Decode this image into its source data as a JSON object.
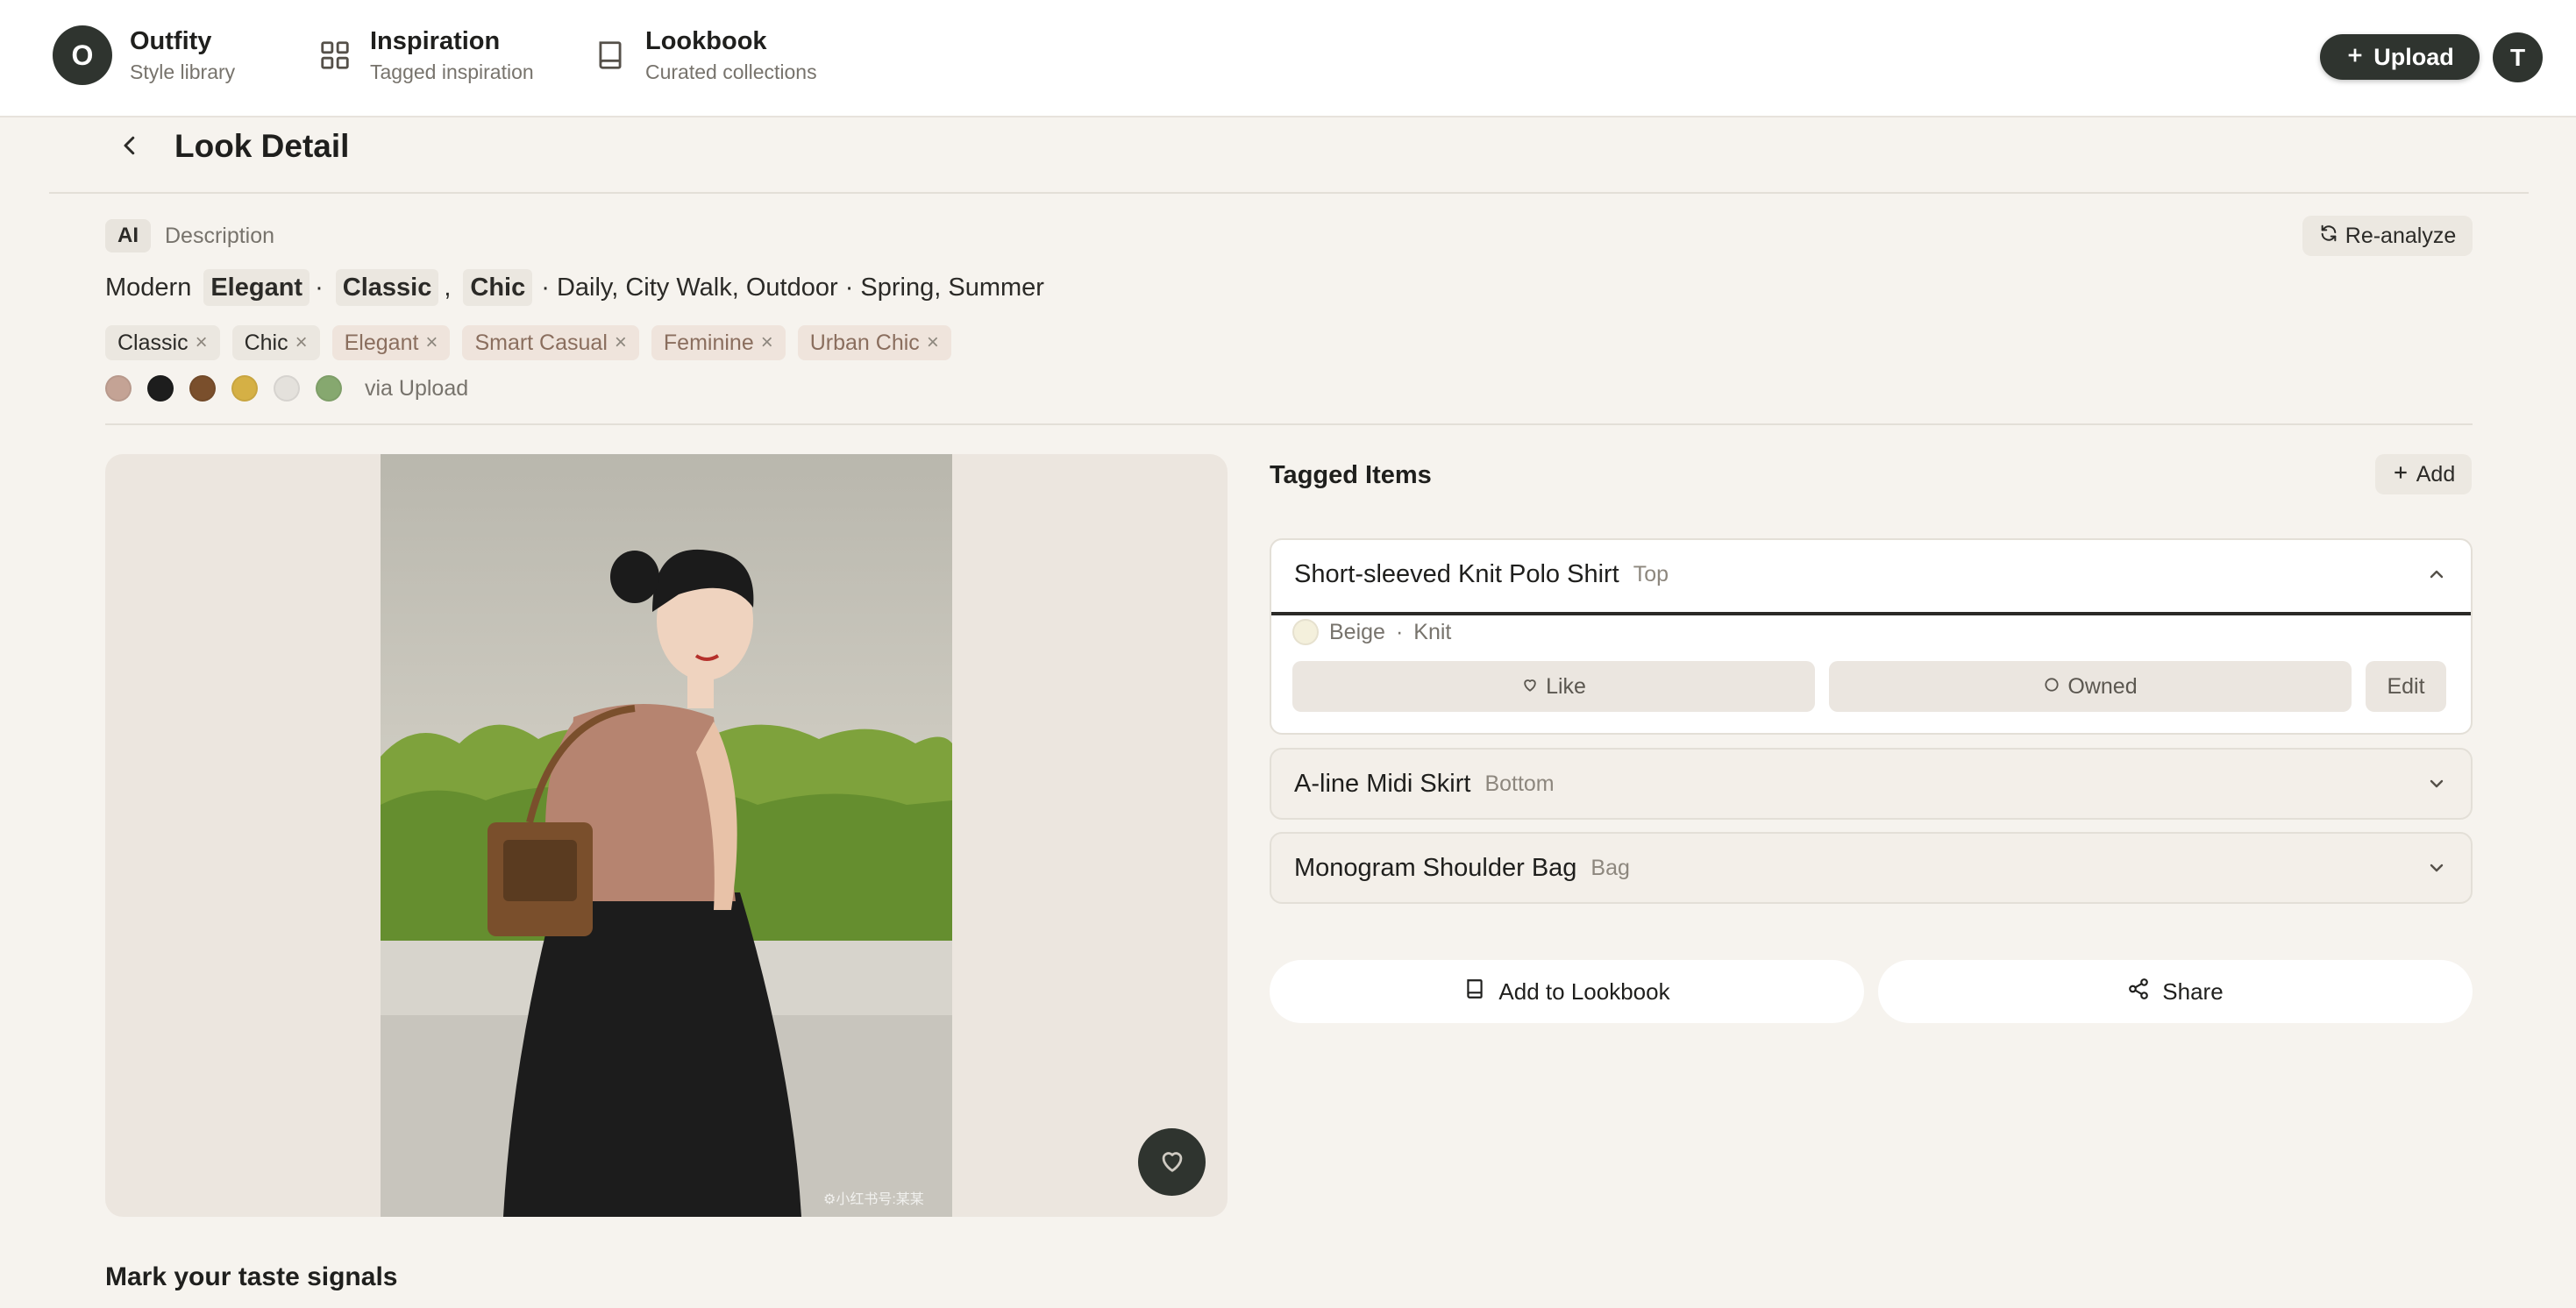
{
  "nav": {
    "brand": {
      "initial": "O",
      "title": "Outfity",
      "subtitle": "Style library"
    },
    "items": [
      {
        "title": "Inspiration",
        "subtitle": "Tagged inspiration",
        "icon": "grid-icon"
      },
      {
        "title": "Lookbook",
        "subtitle": "Curated collections",
        "icon": "book-icon"
      }
    ],
    "upload_label": "Upload",
    "user_initial": "T"
  },
  "header": {
    "title": "Look Detail"
  },
  "description": {
    "badge": "AI",
    "label": "Description",
    "reanalyze_label": "Re-analyze",
    "line": {
      "prefix": "Modern",
      "highlight_1": "Elegant",
      "sep_1": "·",
      "highlight_2": "Classic",
      "sep_2": ",",
      "highlight_3": "Chic",
      "suffix": "· Daily, City Walk, Outdoor · Spring, Summer"
    },
    "tags": [
      "Classic",
      "Chic",
      "Elegant",
      "Smart Casual",
      "Feminine",
      "Urban Chic"
    ],
    "tag_remove": "×",
    "colors": [
      "#c4a395",
      "#1d1d1d",
      "#7a4f2c",
      "#d5b045",
      "#e4e1dc",
      "#86a86f"
    ],
    "source": "via Upload"
  },
  "image": {
    "watermark": "⚙小红书号:某某"
  },
  "tagged_items": {
    "title": "Tagged Items",
    "add_label": "Add",
    "items": [
      {
        "name": "Short-sleeved Knit Polo Shirt",
        "category": "Top",
        "color_name": "Beige",
        "separator": "·",
        "material": "Knit",
        "like_label": "Like",
        "owned_label": "Owned",
        "edit_label": "Edit"
      },
      {
        "name": "A-line Midi Skirt",
        "category": "Bottom"
      },
      {
        "name": "Monogram Shoulder Bag",
        "category": "Bag"
      }
    ]
  },
  "actions": {
    "lookbook_label": "Add to Lookbook",
    "share_label": "Share"
  },
  "taste": {
    "title": "Mark your taste signals"
  }
}
